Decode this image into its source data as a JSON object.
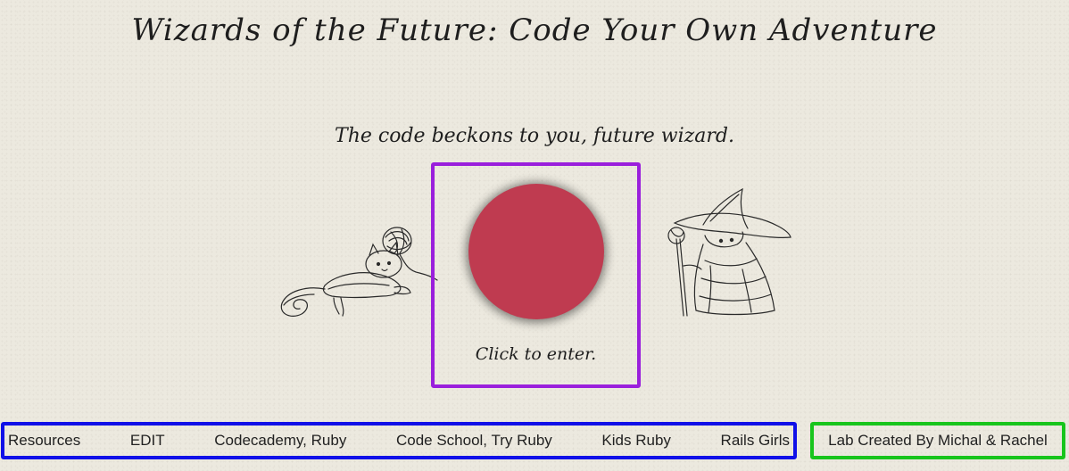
{
  "header": {
    "title": "Wizards of the Future: Code Your Own Adventure",
    "subtitle": "The code beckons to you, future wizard."
  },
  "enter": {
    "label": "Click to enter.",
    "button_color": "#bf3b50",
    "box_color": "#9a1fdc"
  },
  "illustrations": {
    "left": "cat-sketch-icon",
    "right": "wizard-sketch-icon"
  },
  "nav": {
    "border_color": "#1010e8",
    "links": [
      {
        "label": "Resources"
      },
      {
        "label": "EDIT"
      },
      {
        "label": "Codecademy, Ruby"
      },
      {
        "label": "Code School, Try Ruby"
      },
      {
        "label": "Kids Ruby"
      },
      {
        "label": "Rails Girls"
      }
    ]
  },
  "credit": {
    "text": "Lab Created By Michal & Rachel",
    "border_color": "#18c51c"
  }
}
